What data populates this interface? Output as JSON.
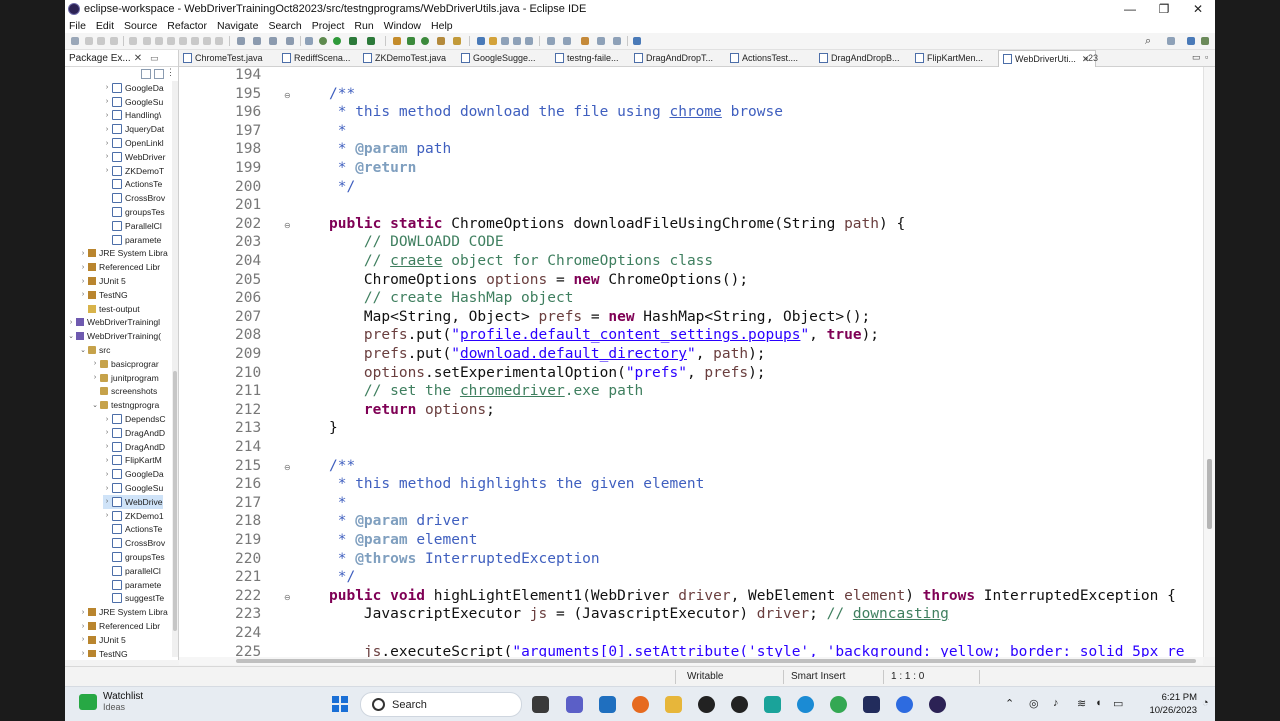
{
  "window": {
    "title": "eclipse-workspace - WebDriverTrainingOct82023/src/testngprograms/WebDriverUtils.java - Eclipse IDE",
    "controls": [
      "—",
      "❐",
      "✕"
    ]
  },
  "menu": [
    "File",
    "Edit",
    "Source",
    "Refactor",
    "Navigate",
    "Search",
    "Project",
    "Run",
    "Window",
    "Help"
  ],
  "package_explorer": {
    "title": "Package Ex...",
    "close": "✕",
    "items": [
      {
        "label": "GoogleDa",
        "indent": 3,
        "icon": "java",
        "arrow": "›"
      },
      {
        "label": "GoogleSu",
        "indent": 3,
        "icon": "java",
        "arrow": "›"
      },
      {
        "label": "Handling\\",
        "indent": 3,
        "icon": "java",
        "arrow": "›"
      },
      {
        "label": "JqueryDat",
        "indent": 3,
        "icon": "java",
        "arrow": "›"
      },
      {
        "label": "OpenLinkl",
        "indent": 3,
        "icon": "java",
        "arrow": "›"
      },
      {
        "label": "WebDriver",
        "indent": 3,
        "icon": "java",
        "arrow": "›"
      },
      {
        "label": "ZKDemoT",
        "indent": 3,
        "icon": "java",
        "arrow": "›"
      },
      {
        "label": "ActionsTe",
        "indent": 3,
        "icon": "java",
        "arrow": ""
      },
      {
        "label": "CrossBrov",
        "indent": 3,
        "icon": "java",
        "arrow": ""
      },
      {
        "label": "groupsTes",
        "indent": 3,
        "icon": "java",
        "arrow": ""
      },
      {
        "label": "ParallelCl",
        "indent": 3,
        "icon": "java",
        "arrow": ""
      },
      {
        "label": "paramete",
        "indent": 3,
        "icon": "java",
        "arrow": ""
      },
      {
        "label": "JRE System Libra",
        "indent": 1,
        "icon": "lib",
        "arrow": "›"
      },
      {
        "label": "Referenced Libr",
        "indent": 1,
        "icon": "lib",
        "arrow": "›"
      },
      {
        "label": "JUnit 5",
        "indent": 1,
        "icon": "lib",
        "arrow": "›"
      },
      {
        "label": "TestNG",
        "indent": 1,
        "icon": "lib",
        "arrow": "›"
      },
      {
        "label": "test-output",
        "indent": 1,
        "icon": "folder",
        "arrow": ""
      },
      {
        "label": "WebDriverTrainingl",
        "indent": 0,
        "icon": "proj",
        "arrow": "›"
      },
      {
        "label": "WebDriverTraining(",
        "indent": 0,
        "icon": "proj",
        "arrow": "⌄"
      },
      {
        "label": "src",
        "indent": 1,
        "icon": "pkgic",
        "arrow": "⌄"
      },
      {
        "label": "basicprograr",
        "indent": 2,
        "icon": "pkgic",
        "arrow": "›"
      },
      {
        "label": "junitprogram",
        "indent": 2,
        "icon": "pkgic",
        "arrow": "›"
      },
      {
        "label": "screenshots",
        "indent": 2,
        "icon": "pkgic",
        "arrow": ""
      },
      {
        "label": "testngprogra",
        "indent": 2,
        "icon": "pkgic",
        "arrow": "⌄"
      },
      {
        "label": "DependsC",
        "indent": 3,
        "icon": "java",
        "arrow": "›"
      },
      {
        "label": "DragAndD",
        "indent": 3,
        "icon": "java",
        "arrow": "›"
      },
      {
        "label": "DragAndD",
        "indent": 3,
        "icon": "java",
        "arrow": "›"
      },
      {
        "label": "FlipKartM",
        "indent": 3,
        "icon": "java",
        "arrow": "›"
      },
      {
        "label": "GoogleDa",
        "indent": 3,
        "icon": "java",
        "arrow": "›"
      },
      {
        "label": "GoogleSu",
        "indent": 3,
        "icon": "java",
        "arrow": "›"
      },
      {
        "label": "WebDrive",
        "indent": 3,
        "icon": "java",
        "arrow": "›",
        "selected": true
      },
      {
        "label": "ZKDemo1",
        "indent": 3,
        "icon": "java",
        "arrow": "›"
      },
      {
        "label": "ActionsTe",
        "indent": 3,
        "icon": "java",
        "arrow": ""
      },
      {
        "label": "CrossBrov",
        "indent": 3,
        "icon": "java",
        "arrow": ""
      },
      {
        "label": "groupsTes",
        "indent": 3,
        "icon": "java",
        "arrow": ""
      },
      {
        "label": "parallelCl",
        "indent": 3,
        "icon": "java",
        "arrow": ""
      },
      {
        "label": "paramete",
        "indent": 3,
        "icon": "java",
        "arrow": ""
      },
      {
        "label": "suggestTe",
        "indent": 3,
        "icon": "java",
        "arrow": ""
      },
      {
        "label": "JRE System Libra",
        "indent": 1,
        "icon": "lib",
        "arrow": "›"
      },
      {
        "label": "Referenced Libr",
        "indent": 1,
        "icon": "lib",
        "arrow": "›"
      },
      {
        "label": "JUnit 5",
        "indent": 1,
        "icon": "lib",
        "arrow": "›"
      },
      {
        "label": "TestNG",
        "indent": 1,
        "icon": "lib",
        "arrow": "›"
      }
    ]
  },
  "editor_tabs": [
    {
      "label": "ChromeTest.java"
    },
    {
      "label": "RediffScena..."
    },
    {
      "label": "ZKDemoTest.java"
    },
    {
      "label": "GoogleSugge..."
    },
    {
      "label": "testng-faile..."
    },
    {
      "label": "DragAndDropT..."
    },
    {
      "label": "ActionsTest...."
    },
    {
      "label": "DragAndDropB..."
    },
    {
      "label": "FlipKartMen..."
    },
    {
      "label": "WebDriverUti...",
      "active": true
    }
  ],
  "editor_tab_overflow": "»23",
  "code_lines": [
    {
      "n": "194",
      "f": "",
      "h": ""
    },
    {
      "n": "195",
      "f": "⊖",
      "h": "<span class=\"jd\">/**</span>"
    },
    {
      "n": "196",
      "f": "",
      "h": "<span class=\"jd\"> * this method download the file using <span class=\"u\">chrome</span> browse</span>"
    },
    {
      "n": "197",
      "f": "",
      "h": "<span class=\"jd\"> *</span>"
    },
    {
      "n": "198",
      "f": "",
      "h": "<span class=\"jd\"> * </span><span class=\"tag\">@param</span><span class=\"jd\"> path</span>"
    },
    {
      "n": "199",
      "f": "",
      "h": "<span class=\"jd\"> * </span><span class=\"tag\">@return</span>"
    },
    {
      "n": "200",
      "f": "",
      "h": "<span class=\"jd\"> */</span>"
    },
    {
      "n": "201",
      "f": "",
      "h": ""
    },
    {
      "n": "202",
      "f": "⊖",
      "h": "<span class=\"k\">public static</span> ChromeOptions downloadFileUsingChrome(String <span class=\"v\">path</span>) {"
    },
    {
      "n": "203",
      "f": "",
      "h": "    <span class=\"c\">// DOWLOADD CODE</span>"
    },
    {
      "n": "204",
      "f": "",
      "h": "    <span class=\"c\">// <span class=\"u\">craete</span> object for ChromeOptions class</span>"
    },
    {
      "n": "205",
      "f": "",
      "h": "    ChromeOptions <span class=\"v\">options</span> = <span class=\"k\">new</span> ChromeOptions();"
    },
    {
      "n": "206",
      "f": "",
      "h": "    <span class=\"c\">// create HashMap object</span>"
    },
    {
      "n": "207",
      "f": "",
      "h": "    Map&lt;String, Object&gt; <span class=\"v\">prefs</span> = <span class=\"k\">new</span> HashMap&lt;String, Object&gt;();"
    },
    {
      "n": "208",
      "f": "",
      "h": "    <span class=\"v\">prefs</span>.put(<span class=\"s\">\"<span class=\"u\">profile.default_content_settings.popups</span>\"</span>, <span class=\"k\">true</span>);"
    },
    {
      "n": "209",
      "f": "",
      "h": "    <span class=\"v\">prefs</span>.put(<span class=\"s\">\"<span class=\"u\">download.default_directory</span>\"</span>, <span class=\"v\">path</span>);"
    },
    {
      "n": "210",
      "f": "",
      "h": "    <span class=\"v\">options</span>.setExperimentalOption(<span class=\"s\">\"prefs\"</span>, <span class=\"v\">prefs</span>);"
    },
    {
      "n": "211",
      "f": "",
      "h": "    <span class=\"c\">// set the <span class=\"u\">chromedriver</span>.exe path</span>"
    },
    {
      "n": "212",
      "f": "",
      "h": "    <span class=\"k\">return</span> <span class=\"v\">options</span>;"
    },
    {
      "n": "213",
      "f": "",
      "h": "}"
    },
    {
      "n": "214",
      "f": "",
      "h": ""
    },
    {
      "n": "215",
      "f": "⊖",
      "h": "<span class=\"jd\">/**</span>"
    },
    {
      "n": "216",
      "f": "",
      "h": "<span class=\"jd\"> * this method highlights the given element</span>"
    },
    {
      "n": "217",
      "f": "",
      "h": "<span class=\"jd\"> *</span>"
    },
    {
      "n": "218",
      "f": "",
      "h": "<span class=\"jd\"> * </span><span class=\"tag\">@param</span><span class=\"jd\"> driver</span>"
    },
    {
      "n": "219",
      "f": "",
      "h": "<span class=\"jd\"> * </span><span class=\"tag\">@param</span><span class=\"jd\"> element</span>"
    },
    {
      "n": "220",
      "f": "",
      "h": "<span class=\"jd\"> * </span><span class=\"tag\">@throws</span><span class=\"jd\"> InterruptedException</span>"
    },
    {
      "n": "221",
      "f": "",
      "h": "<span class=\"jd\"> */</span>"
    },
    {
      "n": "222",
      "f": "⊖",
      "h": "<span class=\"k\">public void</span> highLightElement1(WebDriver <span class=\"v\">driver</span>, WebElement <span class=\"v\">element</span>) <span class=\"k\">throws</span> InterruptedException {"
    },
    {
      "n": "223",
      "f": "",
      "h": "    JavascriptExecutor <span class=\"v\">js</span> = (JavascriptExecutor) <span class=\"v\">driver</span>; <span class=\"c\">// <span class=\"u\">downcasting</span></span>"
    },
    {
      "n": "224",
      "f": "",
      "h": ""
    },
    {
      "n": "225",
      "f": "",
      "h": "    <span class=\"v\">js</span>.executeScript(<span class=\"s\">\"arguments[0].setAttribute('style', 'background: yellow; border: solid 5px re</span>"
    }
  ],
  "status": {
    "writable": "Writable",
    "insert_mode": "Smart Insert",
    "position": "1 : 1 : 0"
  },
  "taskbar": {
    "widget_title": "Watchlist",
    "widget_sub": "Ideas",
    "search_placeholder": "Search",
    "time": "6:21 PM",
    "date": "10/26/2023"
  },
  "colors": {
    "keyword": "#7f0055",
    "comment": "#3f7f5f",
    "javadoc": "#3f5fbf",
    "string": "#2a00ff",
    "variable": "#6a3e3e",
    "selection": "#cfe3f8"
  }
}
